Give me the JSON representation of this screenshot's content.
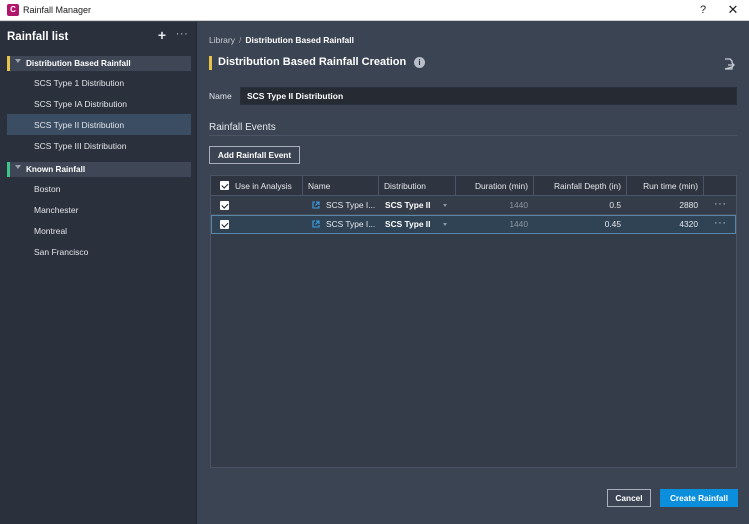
{
  "window": {
    "title": "Rainfall Manager",
    "help_glyph": "?",
    "close_glyph": "✕"
  },
  "sidebar": {
    "title": "Rainfall list",
    "groups": [
      {
        "label": "Distribution Based Rainfall",
        "accent_color": "#e8c34a",
        "items": [
          {
            "label": "SCS Type 1 Distribution"
          },
          {
            "label": "SCS Type IA Distribution"
          },
          {
            "label": "SCS Type II Distribution",
            "selected": true
          },
          {
            "label": "SCS Type III Distribution"
          }
        ]
      },
      {
        "label": "Known Rainfall",
        "accent_color": "#3cc48a",
        "items": [
          {
            "label": "Boston"
          },
          {
            "label": "Manchester"
          },
          {
            "label": "Montreal"
          },
          {
            "label": "San Francisco"
          }
        ]
      }
    ]
  },
  "breadcrumb": {
    "root": "Library",
    "separator": "/",
    "current": "Distribution Based Rainfall"
  },
  "main": {
    "title": "Distribution Based Rainfall Creation",
    "name_label": "Name",
    "name_value": "SCS Type II Distribution",
    "events_title": "Rainfall Events",
    "add_button": "Add Rainfall Event"
  },
  "table": {
    "columns": {
      "use": "Use in Analysis",
      "name": "Name",
      "distribution": "Distribution",
      "duration": "Duration (min)",
      "depth": "Rainfall Depth (in)",
      "runtime": "Run time (min)"
    },
    "rows": [
      {
        "use": true,
        "name": "SCS Type I...",
        "distribution": "SCS Type II",
        "duration": "1440",
        "depth": "0.5",
        "runtime": "2880",
        "selected": false
      },
      {
        "use": true,
        "name": "SCS Type I...",
        "distribution": "SCS Type II",
        "duration": "1440",
        "depth": "0.45",
        "runtime": "4320",
        "selected": true
      }
    ]
  },
  "footer": {
    "cancel": "Cancel",
    "create": "Create Rainfall"
  },
  "colors": {
    "primary_button": "#0b8fdc",
    "selection": "#3a4d63",
    "brand": "#b0166b"
  },
  "icons": [
    "app-icon",
    "add-icon",
    "more-icon",
    "chevron-down-icon",
    "info-icon",
    "export-icon",
    "external-link-icon",
    "checkbox-icon"
  ]
}
